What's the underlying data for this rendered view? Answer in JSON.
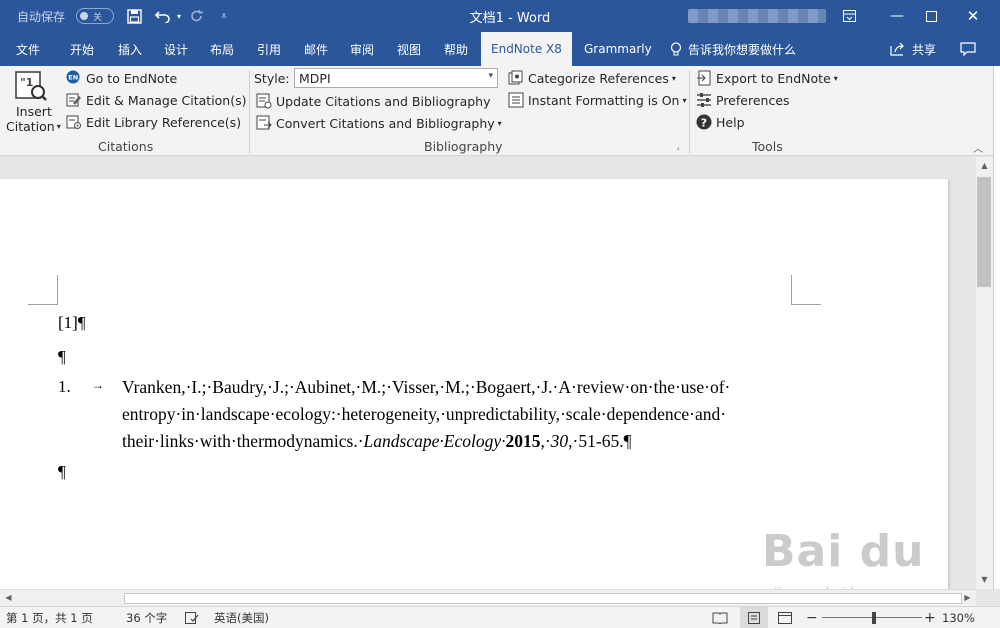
{
  "titlebar": {
    "autosave_label": "自动保存",
    "autosave_state": "关",
    "doc_title": "文档1  -  Word",
    "save_icon": "save-icon",
    "undo_icon": "undo-icon",
    "redo_icon": "redo-icon"
  },
  "menu_tabs": [
    {
      "label": "文件"
    },
    {
      "label": "开始"
    },
    {
      "label": "插入"
    },
    {
      "label": "设计"
    },
    {
      "label": "布局"
    },
    {
      "label": "引用"
    },
    {
      "label": "邮件"
    },
    {
      "label": "审阅"
    },
    {
      "label": "视图"
    },
    {
      "label": "帮助"
    },
    {
      "label": "EndNote X8",
      "active": true
    },
    {
      "label": "Grammarly"
    }
  ],
  "tell_me": "告诉我你想要做什么",
  "share_label": "共享",
  "ribbon": {
    "insert_citation_line1": "Insert",
    "insert_citation_line2": "Citation",
    "go_to_endnote": "Go to EndNote",
    "edit_manage_citations": "Edit & Manage Citation(s)",
    "edit_library_references": "Edit Library Reference(s)",
    "citations_group": "Citations",
    "style_label": "Style:",
    "style_value": "MDPI",
    "update_citations": "Update Citations and Bibliography",
    "convert_citations": "Convert Citations and Bibliography",
    "bibliography_group": "Bibliography",
    "categorize_references": "Categorize References",
    "instant_formatting": "Instant Formatting is On",
    "export_to_endnote": "Export to EndNote",
    "preferences": "Preferences",
    "help": "Help",
    "tools_group": "Tools"
  },
  "document": {
    "citation_line": "[1]¶",
    "empty_para_1": "¶",
    "ref_number": "1.",
    "ref_tab": "→",
    "ref_line1": "Vranken,·I.;·Baudry,·J.;·Aubinet,·M.;·Visser,·M.;·Bogaert,·J.·A·review·on·the·use·of·",
    "ref_line2": "entropy·in·landscape·ecology:·heterogeneity,·unpredictability,·scale·dependence·and·",
    "ref_line3_plain": "their·links·with·thermodynamics.·",
    "ref_line3_journal": "Landscape·Ecology·",
    "ref_line3_year": "2015",
    "ref_line3_comma1": ",·",
    "ref_line3_volume": "30",
    "ref_line3_pages": ",·51-65.¶",
    "empty_para_2": "¶"
  },
  "status": {
    "page_info": "第 1 页，共 1 页",
    "word_count": "36 个字",
    "language": "英语(美国)",
    "zoom_minus": "−",
    "zoom_plus": "+",
    "zoom_level": "130%"
  },
  "watermark": {
    "main": "Bai du 经验",
    "sub": "jingyan.baidu.com"
  },
  "colors": {
    "titlebar": "#2b579a",
    "ribbon": "#f3f3f3",
    "active_tab_text": "#2b579a"
  }
}
